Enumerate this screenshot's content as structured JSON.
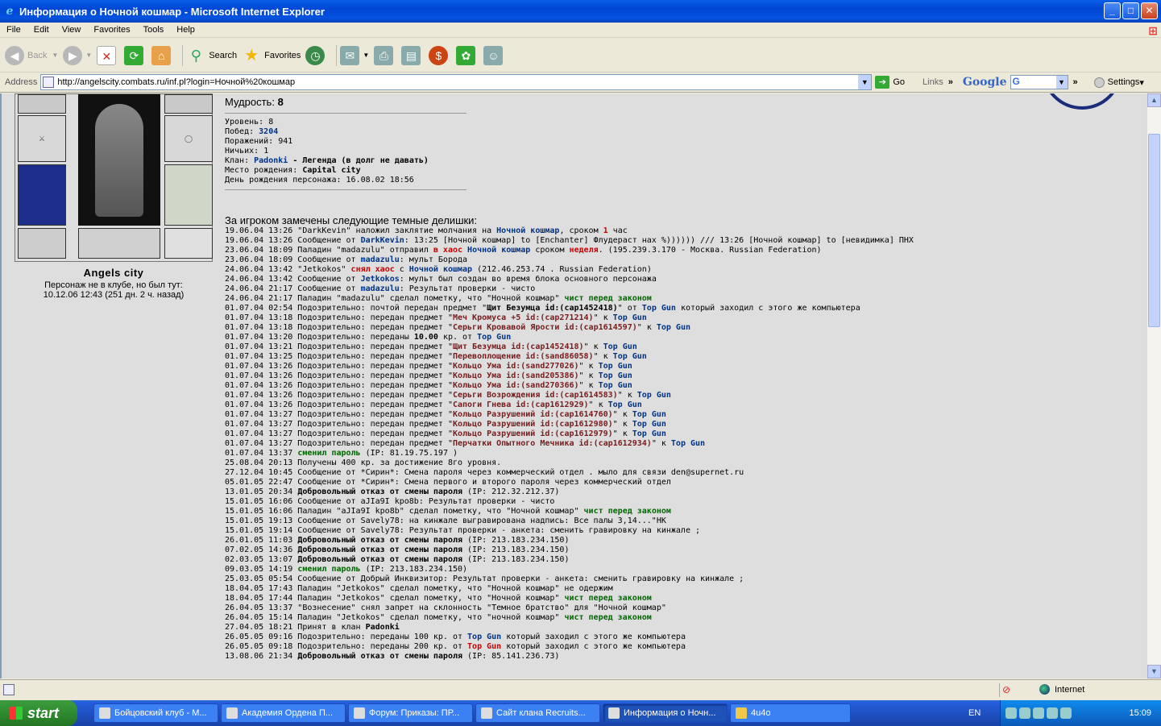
{
  "window": {
    "title": "Информация о Ночной кошмар - Microsoft Internet Explorer",
    "buttons": [
      "_",
      "□",
      "✕"
    ]
  },
  "menu": [
    "File",
    "Edit",
    "View",
    "Favorites",
    "Tools",
    "Help"
  ],
  "toolbar": {
    "back": "Back",
    "search": "Search",
    "favorites": "Favorites"
  },
  "address": {
    "label": "Address",
    "url": "http://angelscity.combats.ru/inf.pl?login=Ночной%20кошмар",
    "go": "Go",
    "links": "Links",
    "google": "Google",
    "settings": "Settings"
  },
  "character": {
    "city": "Angels city",
    "club_status": "Персонаж не в клубе, но был тут:",
    "last_seen": "10.12.06 12:43 (251 дн. 2 ч. назад)"
  },
  "stats": {
    "wisdom_label": "Мудрость:",
    "wisdom_value": "8",
    "level_label": "Уровень:",
    "level": "8",
    "wins_label": "Побед:",
    "wins": "3204",
    "losses_label": "Поражений:",
    "losses": "941",
    "draws_label": "Ничьих:",
    "draws": "1",
    "clan_label": "Клан:",
    "clan": "Padonki",
    "clan_desc": "- Легенда (в долг не давать)",
    "birthplace_label": "Место рождения:",
    "birthplace": "Capital city",
    "birthday_label": "День рождения персонажа:",
    "birthday": "16.08.02 18:56"
  },
  "log_title": "За игроком замечены следующие темные делишки:",
  "log": [
    [
      [
        "19.06.04 13:26 \"DarkKevin\" наложил заклятие молчания на ",
        ""
      ],
      [
        "Ночной кошмар",
        "u"
      ],
      [
        ", сроком ",
        ""
      ],
      [
        "1",
        "r"
      ],
      [
        " час",
        ""
      ]
    ],
    [
      [
        "19.06.04 13:26 Сообщение от ",
        ""
      ],
      [
        "DarkKevin",
        "u"
      ],
      [
        ": 13:25 [Ночной кошмар] to [Enchanter] Флудераст нах %)))))) /// 13:26 [Ночной кошмар] to [невидимка] ПНХ",
        ""
      ]
    ],
    [
      [
        "23.06.04 18:09 Паладин \"madazulu\" отправил ",
        ""
      ],
      [
        "в хаос",
        "r"
      ],
      [
        " ",
        ""
      ],
      [
        "Ночной кошмар",
        "u"
      ],
      [
        " сроком ",
        ""
      ],
      [
        "неделя",
        "r"
      ],
      [
        ". (195.239.3.170 - Москва. Russian Federation)",
        ""
      ]
    ],
    [
      [
        "23.06.04 18:09 Сообщение от ",
        ""
      ],
      [
        "madazulu",
        "u"
      ],
      [
        ": мульт Борода",
        ""
      ]
    ],
    [
      [
        "24.06.04 13:42 \"Jetkokos\" ",
        ""
      ],
      [
        "снял хаос",
        "r"
      ],
      [
        " с ",
        ""
      ],
      [
        "Ночной кошмар",
        "u"
      ],
      [
        " (212.46.253.74 . Russian Federation)",
        ""
      ]
    ],
    [
      [
        "24.06.04 13:42 Сообщение от ",
        ""
      ],
      [
        "Jetkokos",
        "u"
      ],
      [
        ": мульт был создан во время блока основного персонажа",
        ""
      ]
    ],
    [
      [
        "24.06.04 21:17 Сообщение от ",
        ""
      ],
      [
        "madazulu",
        "u"
      ],
      [
        ": Результат проверки - чисто",
        ""
      ]
    ],
    [
      [
        "24.06.04 21:17 Паладин \"madazulu\" сделал пометку, что \"Ночной кошмар\" ",
        ""
      ],
      [
        "чист перед законом",
        "g"
      ]
    ],
    [
      [
        "01.07.04 02:54 Подозрительно: почтой передан предмет \"",
        ""
      ],
      [
        "Щит Безумца id:(cap1452418)",
        "b"
      ],
      [
        "\" от ",
        ""
      ],
      [
        "Top Gun",
        "u"
      ],
      [
        " который заходил с этого же компьютера",
        ""
      ]
    ],
    [
      [
        "01.07.04 13:18 Подозрительно: передан предмет \"",
        ""
      ],
      [
        "Меч Кромуса +5 id:(cap271214)",
        "it"
      ],
      [
        "\" к ",
        ""
      ],
      [
        "Top Gun",
        "u"
      ]
    ],
    [
      [
        "01.07.04 13:18 Подозрительно: передан предмет \"",
        ""
      ],
      [
        "Серьги Кровавой Ярости id:(cap1614597)",
        "it"
      ],
      [
        "\" к ",
        ""
      ],
      [
        "Top Gun",
        "u"
      ]
    ],
    [
      [
        "01.07.04 13:20 Подозрительно: переданы ",
        ""
      ],
      [
        "10.00",
        "b"
      ],
      [
        " кр. от ",
        ""
      ],
      [
        "Top Gun",
        "u"
      ]
    ],
    [
      [
        "01.07.04 13:21 Подозрительно: передан предмет \"",
        ""
      ],
      [
        "Щит Безумца id:(cap1452418)",
        "it"
      ],
      [
        "\" к ",
        ""
      ],
      [
        "Top Gun",
        "u"
      ]
    ],
    [
      [
        "01.07.04 13:25 Подозрительно: передан предмет \"",
        ""
      ],
      [
        "Перевоплощение id:(sand86058)",
        "it"
      ],
      [
        "\" к ",
        ""
      ],
      [
        "Top Gun",
        "u"
      ]
    ],
    [
      [
        "01.07.04 13:26 Подозрительно: передан предмет \"",
        ""
      ],
      [
        "Кольцо Ума id:(sand277026)",
        "it"
      ],
      [
        "\" к ",
        ""
      ],
      [
        "Top Gun",
        "u"
      ]
    ],
    [
      [
        "01.07.04 13:26 Подозрительно: передан предмет \"",
        ""
      ],
      [
        "Кольцо Ума id:(sand205386)",
        "it"
      ],
      [
        "\" к ",
        ""
      ],
      [
        "Top Gun",
        "u"
      ]
    ],
    [
      [
        "01.07.04 13:26 Подозрительно: передан предмет \"",
        ""
      ],
      [
        "Кольцо Ума id:(sand270366)",
        "it"
      ],
      [
        "\" к ",
        ""
      ],
      [
        "Top Gun",
        "u"
      ]
    ],
    [
      [
        "01.07.04 13:26 Подозрительно: передан предмет \"",
        ""
      ],
      [
        "Серьги Возрождения id:(cap1614583)",
        "it"
      ],
      [
        "\" к ",
        ""
      ],
      [
        "Top Gun",
        "u"
      ]
    ],
    [
      [
        "01.07.04 13:26 Подозрительно: передан предмет \"",
        ""
      ],
      [
        "Сапоги Гнева id:(cap1612929)",
        "it"
      ],
      [
        "\" к ",
        ""
      ],
      [
        "Top Gun",
        "u"
      ]
    ],
    [
      [
        "01.07.04 13:27 Подозрительно: передан предмет \"",
        ""
      ],
      [
        "Кольцо Разрушений id:(cap1614760)",
        "it"
      ],
      [
        "\" к ",
        ""
      ],
      [
        "Top Gun",
        "u"
      ]
    ],
    [
      [
        "01.07.04 13:27 Подозрительно: передан предмет \"",
        ""
      ],
      [
        "Кольцо Разрушений id:(cap1612980)",
        "it"
      ],
      [
        "\" к ",
        ""
      ],
      [
        "Top Gun",
        "u"
      ]
    ],
    [
      [
        "01.07.04 13:27 Подозрительно: передан предмет \"",
        ""
      ],
      [
        "Кольцо Разрушений id:(cap1612979)",
        "it"
      ],
      [
        "\" к ",
        ""
      ],
      [
        "Top Gun",
        "u"
      ]
    ],
    [
      [
        "01.07.04 13:27 Подозрительно: передан предмет \"",
        ""
      ],
      [
        "Перчатки Опытного Мечника id:(cap1612934)",
        "it"
      ],
      [
        "\" к ",
        ""
      ],
      [
        "Top Gun",
        "u"
      ]
    ],
    [
      [
        "01.07.04 13:37 ",
        ""
      ],
      [
        "сменил пароль",
        "g"
      ],
      [
        " (IP: 81.19.75.197 )",
        ""
      ]
    ],
    [
      [
        "25.08.04 20:13 Получены 400 кр. за достижение 8го уровня.",
        ""
      ]
    ],
    [
      [
        "27.12.04 10:45 Сообщение от *Сирин*: Смена пароля через коммерческий отдел . мыло для связи den@supernet.ru",
        ""
      ]
    ],
    [
      [
        "05.01.05 22:47 Сообщение от *Сирин*: Смена первого и второго пароля через коммерческий отдел",
        ""
      ]
    ],
    [
      [
        "13.01.05 20:34 ",
        ""
      ],
      [
        "Добровольный отказ от смены пароля",
        "b"
      ],
      [
        " (IP: 212.32.212.37)",
        ""
      ]
    ],
    [
      [
        "15.01.05 16:06 Сообщение от aJIa9I kpo8b: Результат проверки - чисто",
        ""
      ]
    ],
    [
      [
        "15.01.05 16:06 Паладин \"aJIa9I kpo8b\" сделал пометку, что \"Ночной кошмар\" ",
        ""
      ],
      [
        "чист перед законом",
        "g"
      ]
    ],
    [
      [
        "15.01.05 19:13 Сообщение от Savely78: на кинжале выгравирована надпись: Все палы 3,14...\"НК",
        ""
      ]
    ],
    [
      [
        "15.01.05 19:14 Сообщение от Savely78: Результат проверки - анкета: сменить гравировку на кинжале ;",
        ""
      ]
    ],
    [
      [
        "26.01.05 11:03 ",
        ""
      ],
      [
        "Добровольный отказ от смены пароля",
        "b"
      ],
      [
        " (IP: 213.183.234.150)",
        ""
      ]
    ],
    [
      [
        "07.02.05 14:36 ",
        ""
      ],
      [
        "Добровольный отказ от смены пароля",
        "b"
      ],
      [
        " (IP: 213.183.234.150)",
        ""
      ]
    ],
    [
      [
        "02.03.05 13:07 ",
        ""
      ],
      [
        "Добровольный отказ от смены пароля",
        "b"
      ],
      [
        " (IP: 213.183.234.150)",
        ""
      ]
    ],
    [
      [
        "09.03.05 14:19 ",
        ""
      ],
      [
        "сменил пароль",
        "g"
      ],
      [
        " (IP: 213.183.234.150)",
        ""
      ]
    ],
    [
      [
        "25.03.05 05:54 Сообщение от Добрый Инквизитор: Результат проверки - анкета: сменить гравировку на кинжале ;",
        ""
      ]
    ],
    [
      [
        "18.04.05 17:43 Паладин \"Jetkokos\" сделал пометку, что \"Ночной кошмар\" не одержим",
        ""
      ]
    ],
    [
      [
        "18.04.05 17:44 Паладин \"Jetkokos\" сделал пометку, что \"Ночной кошмар\" ",
        ""
      ],
      [
        "чист перед законом",
        "g"
      ]
    ],
    [
      [
        "26.04.05 13:37 \"Вознесение\" снял запрет на склонность \"Темное братство\" для \"Ночной кошмар\"",
        ""
      ]
    ],
    [
      [
        "26.04.05 15:14 Паладин \"Jetkokos\" сделал пометку, что \"ночной кошмар\" ",
        ""
      ],
      [
        "чист перед законом",
        "g"
      ]
    ],
    [
      [
        "27.04.05 18:21 Принят в клан ",
        ""
      ],
      [
        "Padonki",
        "b"
      ]
    ],
    [
      [
        "26.05.05 09:16 Подозрительно: переданы 100 кр. от ",
        ""
      ],
      [
        "Top Gun",
        "u"
      ],
      [
        " который заходил с этого же компьютера",
        ""
      ]
    ],
    [
      [
        "26.05.05 09:18 Подозрительно: переданы 200 кр. от ",
        ""
      ],
      [
        "Top Gun",
        "r"
      ],
      [
        " который заходил с этого же компьютера",
        ""
      ]
    ],
    [
      [
        "13.08.06 21:34 ",
        ""
      ],
      [
        "Добровольный отказ от смены пароля",
        "b"
      ],
      [
        " (IP: 85.141.236.73)",
        ""
      ]
    ]
  ],
  "statusbar": {
    "zone": "Internet"
  },
  "taskbar": {
    "start": "start",
    "tasks": [
      "Бойцовский клуб - M...",
      "Академия Ордена П...",
      "Форум: Приказы: ПР...",
      "Сайт клана Recruits...",
      "Информация о Ночн...",
      "4u4o"
    ],
    "lang": "EN",
    "clock": "15:09"
  }
}
